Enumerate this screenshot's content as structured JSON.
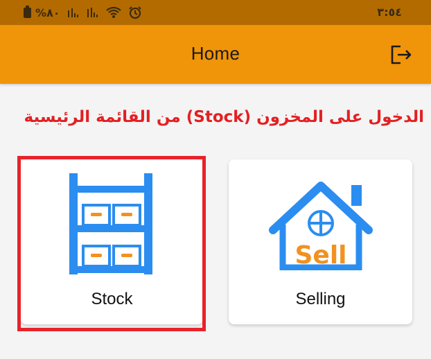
{
  "status_bar": {
    "battery_percent": "%٨٠",
    "time": "٣:٥٤",
    "icons": [
      "battery-icon",
      "signal-icon",
      "signal-icon",
      "wifi-icon",
      "alarm-icon"
    ]
  },
  "app_bar": {
    "title": "Home",
    "logout_icon": "logout-icon",
    "background": "#f0940a"
  },
  "instruction": {
    "text": "الدخول على المخزون (Stock) من القائمة الرئيسية",
    "color": "#e32022"
  },
  "menu": {
    "items": [
      {
        "label": "Stock",
        "icon": "warehouse-shelves-icon",
        "highlighted": true
      },
      {
        "label": "Selling",
        "icon": "sell-house-icon",
        "icon_text": "Sell",
        "highlighted": false
      }
    ]
  },
  "colors": {
    "primary_blue": "#2b8df0",
    "accent_orange": "#f29120",
    "highlight_red": "#e8232a"
  }
}
